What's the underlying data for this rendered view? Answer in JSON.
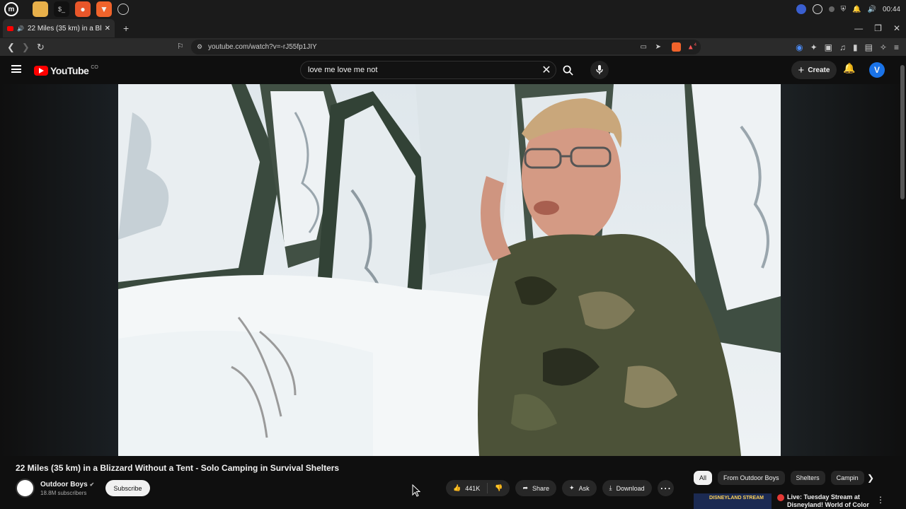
{
  "os": {
    "clock": "00:44",
    "apps": [
      "mint-menu",
      "files",
      "terminal",
      "firefox",
      "brave",
      "clock"
    ]
  },
  "browser": {
    "tab": {
      "title": "22 Miles (35 km) in a Blizza",
      "audio": "🔊"
    },
    "new_tab": "+",
    "url": "youtube.com/watch?v=-rJ55fp1JIY",
    "badge": "4"
  },
  "youtube": {
    "logo_text": "YouTube",
    "logo_sup": "CO",
    "search_value": "love me love me not",
    "create_label": "Create",
    "avatar_letter": "V"
  },
  "video": {
    "title": "22 Miles (35 km) in a Blizzard Without a Tent - Solo Camping in Survival Shelters",
    "channel": "Outdoor Boys",
    "subscribers": "18.8M subscribers",
    "subscribe_label": "Subscribe",
    "likes": "441K",
    "share_label": "Share",
    "ask_label": "Ask",
    "download_label": "Download"
  },
  "chips": [
    "All",
    "From Outdoor Boys",
    "Shelters",
    "Campin"
  ],
  "recommendation": {
    "thumb_text": "DISNEYLAND STREAM",
    "title_line1": "Live: Tuesday Stream at",
    "title_line2": "Disneyland! World of Color"
  },
  "colors": {
    "accent": "#ff0000",
    "background": "#0f0f0f",
    "avatar": "#1a73e8"
  }
}
